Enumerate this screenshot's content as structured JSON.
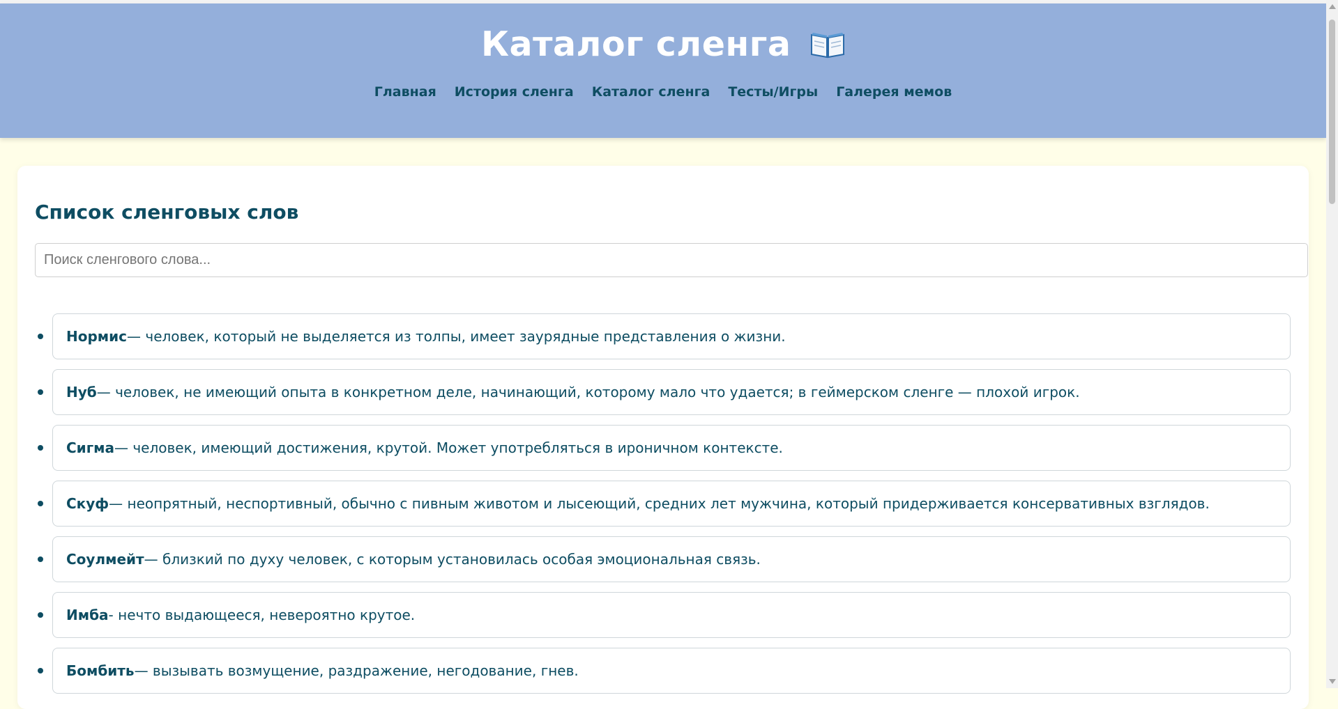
{
  "header": {
    "title": "Каталог сленга",
    "title_icon": "open-book-icon",
    "nav": [
      {
        "label": "Главная"
      },
      {
        "label": "История сленга"
      },
      {
        "label": "Каталог сленга"
      },
      {
        "label": "Тесты/Игры"
      },
      {
        "label": "Галерея мемов"
      }
    ]
  },
  "main": {
    "section_title": "Список сленговых слов",
    "search": {
      "placeholder": "Поиск сленгового слова...",
      "value": ""
    },
    "items": [
      {
        "term": "Нормис",
        "definition": "— человек, который не выделяется из толпы, имеет заурядные представления о жизни."
      },
      {
        "term": "Нуб",
        "definition": "— человек, не имеющий опыта в конкретном деле, начинающий, которому мало что удается; в геймерском сленге — плохой игрок."
      },
      {
        "term": "Сигма",
        "definition": "— человек, имеющий достижения, крутой. Может употребляться в ироничном контексте."
      },
      {
        "term": "Скуф",
        "definition": "— неопрятный, неспортивный, обычно с пивным животом и лысеющий, средних лет мужчина, который придерживается консервативных взглядов."
      },
      {
        "term": "Соулмейт",
        "definition": "— близкий по духу человек, с которым установилась особая эмоциональная связь."
      },
      {
        "term": "Имба",
        "definition": " - нечто выдающееся, невероятно крутое."
      },
      {
        "term": "Бомбить",
        "definition": " — вызывать возмущение, раздражение, негодование, гнев."
      }
    ]
  },
  "colors": {
    "header_bg": "#94afdb",
    "page_bg": "#fffee8",
    "text_primary": "#0e4d62"
  }
}
